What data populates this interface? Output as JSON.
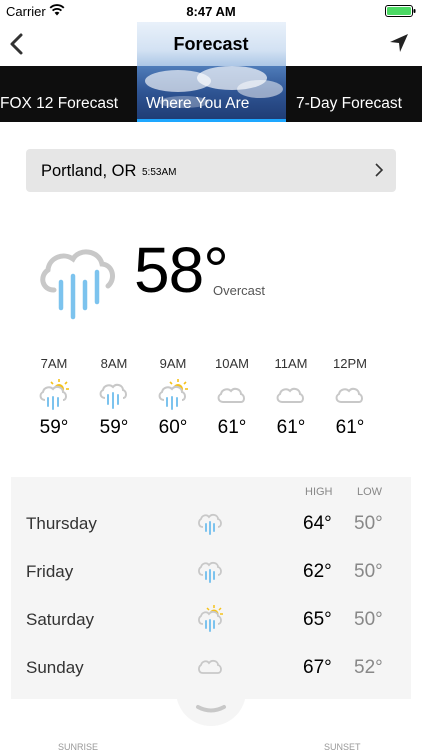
{
  "status_bar": {
    "carrier": "Carrier",
    "time": "8:47 AM"
  },
  "nav": {
    "title": "Forecast"
  },
  "tabs": [
    {
      "label": "FOX 12 Forecast"
    },
    {
      "label": "Where You Are"
    },
    {
      "label": "7-Day Forecast"
    }
  ],
  "location": {
    "city": "Portland, OR",
    "updated": "5:53AM"
  },
  "current": {
    "temp": "58°",
    "condition": "Overcast",
    "icon": "rain-cloud-icon"
  },
  "hourly": [
    {
      "time": "7AM",
      "temp": "59°",
      "icon": "sun-rain-icon"
    },
    {
      "time": "8AM",
      "temp": "59°",
      "icon": "rain-cloud-icon"
    },
    {
      "time": "9AM",
      "temp": "60°",
      "icon": "sun-rain-icon"
    },
    {
      "time": "10AM",
      "temp": "61°",
      "icon": "cloud-icon"
    },
    {
      "time": "11AM",
      "temp": "61°",
      "icon": "cloud-icon"
    },
    {
      "time": "12PM",
      "temp": "61°",
      "icon": "cloud-icon"
    }
  ],
  "daily": {
    "high_label": "HIGH",
    "low_label": "LOW",
    "days": [
      {
        "name": "Thursday",
        "high": "64°",
        "low": "50°",
        "icon": "rain-cloud-icon"
      },
      {
        "name": "Friday",
        "high": "62°",
        "low": "50°",
        "icon": "rain-cloud-icon"
      },
      {
        "name": "Saturday",
        "high": "65°",
        "low": "50°",
        "icon": "sun-rain-icon"
      },
      {
        "name": "Sunday",
        "high": "67°",
        "low": "52°",
        "icon": "cloud-icon"
      }
    ]
  },
  "footer": {
    "sunrise_label": "SUNRISE",
    "sunset_label": "SUNSET"
  },
  "colors": {
    "accent": "#1ea7ff",
    "rain": "#7cc3ee",
    "sun": "#f5c21b",
    "cloud": "#c8c8c8"
  }
}
